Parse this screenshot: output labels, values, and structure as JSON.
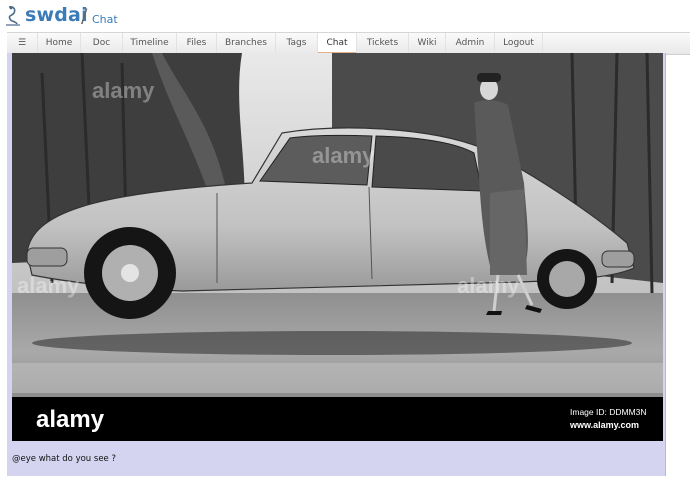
{
  "header": {
    "project": "swdai",
    "separator": "/",
    "subpage": "Chat"
  },
  "menu": {
    "hamburger": "☰",
    "items": [
      {
        "label": "Home"
      },
      {
        "label": "Doc"
      },
      {
        "label": "Timeline"
      },
      {
        "label": "Files"
      },
      {
        "label": "Branches"
      },
      {
        "label": "Tags"
      },
      {
        "label": "Chat",
        "active": true
      },
      {
        "label": "Tickets"
      },
      {
        "label": "Wiki"
      },
      {
        "label": "Admin"
      },
      {
        "label": "Logout"
      }
    ]
  },
  "chat": {
    "image": {
      "watermark": "alamy",
      "footer_brand": "alamy",
      "image_id": "Image ID: DDMM3N",
      "url": "www.alamy.com"
    },
    "message": "@eye what do you see ?"
  },
  "colors": {
    "link": "#3a7bb8",
    "chat_bg": "#d4d4f0",
    "active_tab_underline": "#e3b18b"
  }
}
